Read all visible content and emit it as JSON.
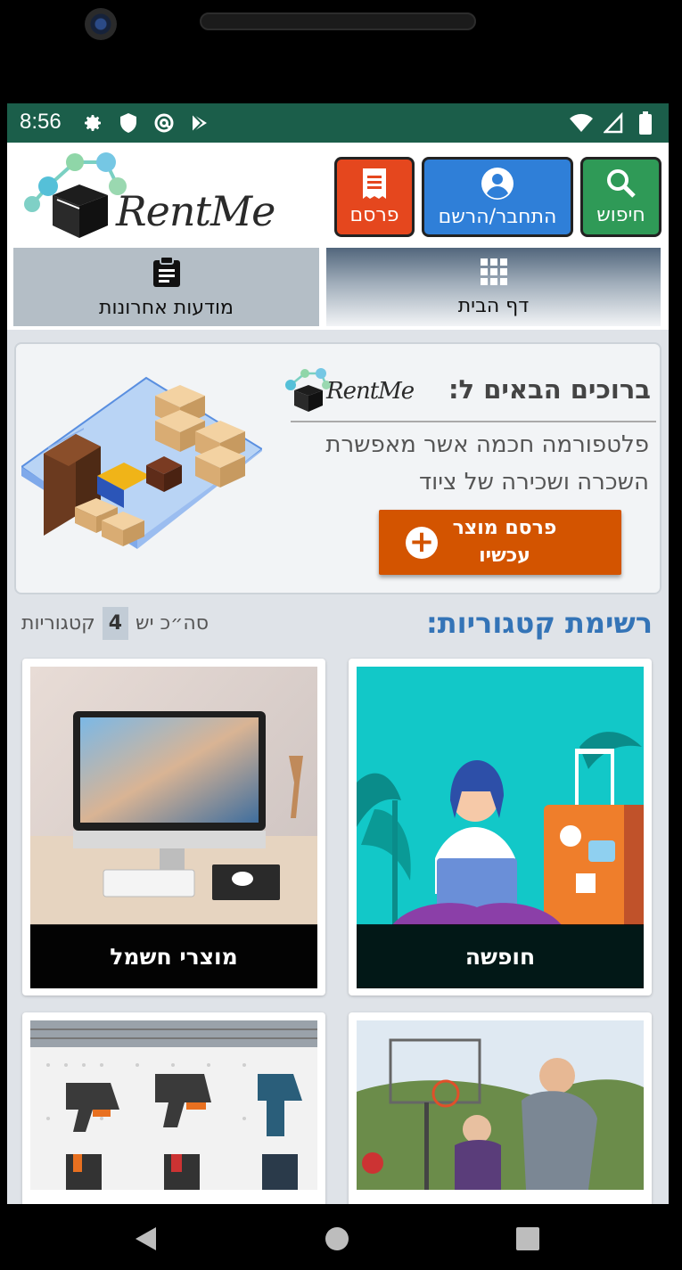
{
  "status_bar": {
    "time": "8:56",
    "left_icons": [
      "gear-icon",
      "shield-icon",
      "at-icon",
      "play-store-icon"
    ],
    "right_icons": [
      "wifi-icon",
      "signal-icon",
      "battery-icon"
    ]
  },
  "header": {
    "logo_text": "RentMe",
    "buttons": {
      "search": "חיפוש",
      "login": "התחבר/הרשם",
      "post": "פרסם"
    }
  },
  "tabs": {
    "home": "דף הבית",
    "recent": "מודעות אחרונות"
  },
  "welcome": {
    "title": "ברוכים הבאים ל:",
    "logo_text": "RentMe",
    "description": "פלטפורמה חכמה אשר מאפשרת השכרה ושכירה של ציוד",
    "cta_label": "פרסם מוצר עכשיו"
  },
  "categories": {
    "title": "רשימת קטגוריות:",
    "count_prefix": "סה״כ יש",
    "count": "4",
    "count_suffix": "קטגוריות",
    "items": [
      {
        "label": "חופשה",
        "image": "vacation-illustration"
      },
      {
        "label": "מוצרי חשמל",
        "image": "computer-photo"
      },
      {
        "label": "",
        "image": "basketball-photo"
      },
      {
        "label": "",
        "image": "power-tools-photo"
      }
    ]
  },
  "colors": {
    "status_bar": "#1b5e4a",
    "search_button": "#2f9a57",
    "login_button": "#2f7fd8",
    "post_button": "#e5471e",
    "cta": "#d35400",
    "category_title": "#3474b7"
  }
}
